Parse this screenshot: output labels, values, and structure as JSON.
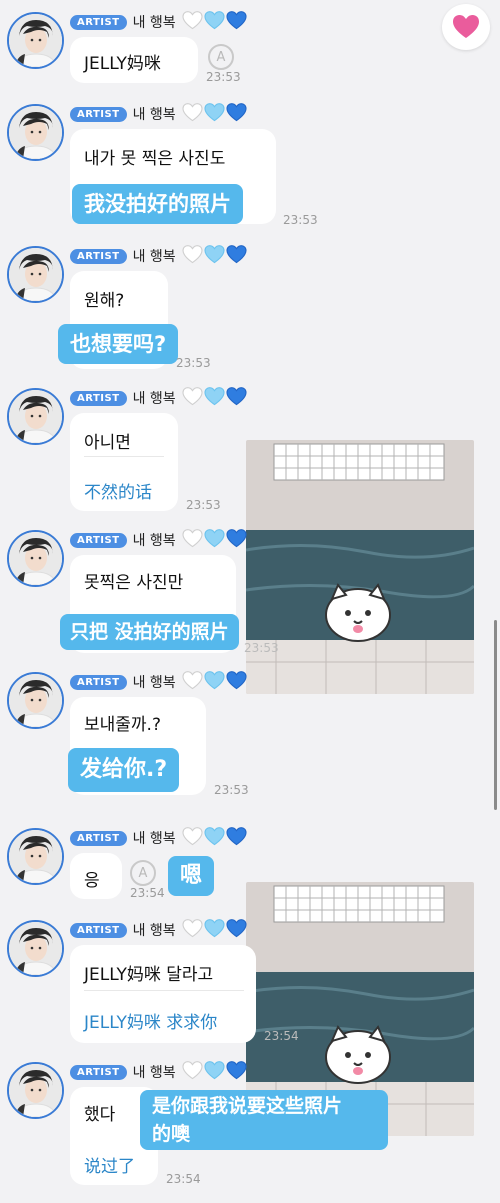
{
  "artist_badge": "ARTIST",
  "sender_name": "내 행복",
  "hearts": [
    "white-heart-icon",
    "light-blue-heart-icon",
    "blue-heart-icon"
  ],
  "colors": {
    "sticker": "#55b8ec",
    "translation_text": "#2b86c8",
    "badge": "#4d8fe3",
    "heart_button": "#ea5c9c"
  },
  "messages": [
    {
      "ko": "JELLY妈咪",
      "time": "23:53"
    },
    {
      "ko": "내가 못 찍은 사진도",
      "overlay": "我没拍好的照片",
      "time": "23:53"
    },
    {
      "ko": "원해?",
      "overlay": "也想要吗?",
      "time": "23:53"
    },
    {
      "ko": "아니면",
      "translation": "不然的话",
      "time": "23:53"
    },
    {
      "ko": "못찍은 사진만",
      "overlay": "只把 没拍好的照片",
      "time": "23:53"
    },
    {
      "ko": "보내줄까.?",
      "overlay": "发给你.?",
      "time": "23:53"
    },
    {
      "ko": "응",
      "overlay": "嗯",
      "time": "23:54"
    },
    {
      "ko": "JELLY妈咪 달라고",
      "translation": "JELLY妈咪 求求你",
      "time": "23:54"
    },
    {
      "ko": "했다",
      "overlay_line1": "是你跟我说要这些照片",
      "overlay_line2": "的噢",
      "translation": "说过了",
      "time": "23:54"
    }
  ]
}
